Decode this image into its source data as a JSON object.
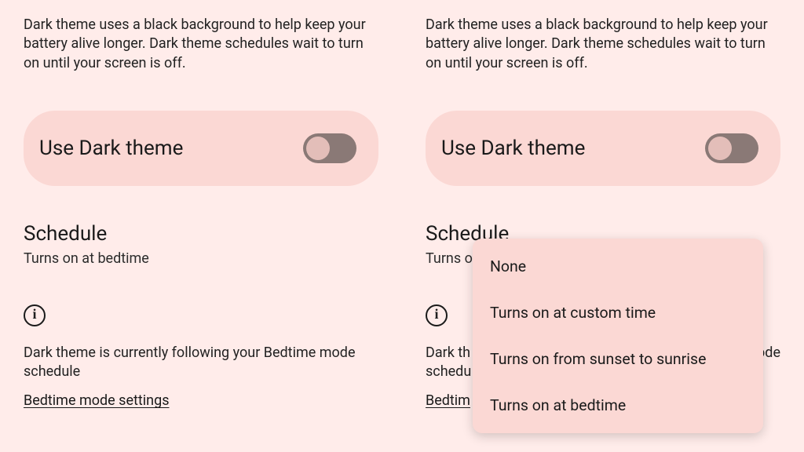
{
  "left": {
    "description": "Dark theme uses a black background to help keep your battery alive longer. Dark theme schedules wait to turn on until your screen is off.",
    "toggle_label": "Use Dark theme",
    "schedule_title": "Schedule",
    "schedule_subtitle": "Turns on at bedtime",
    "info_text": "Dark theme is currently following your Bedtime mode schedule",
    "link_label": "Bedtime mode settings"
  },
  "right": {
    "description": "Dark theme uses a black background to help keep your battery alive longer. Dark theme schedules wait to turn on until your screen is off.",
    "toggle_label": "Use Dark theme",
    "schedule_title": "Schedule",
    "schedule_subtitle_partial": "Turns o",
    "info_text_partial_start": "Dark th",
    "info_text_partial_end": "e mode",
    "info_text_partial_last": "schedu",
    "link_label_partial": "Bedtim",
    "dropdown": {
      "items": [
        "None",
        "Turns on at custom time",
        "Turns on from sunset to sunrise",
        "Turns on at bedtime"
      ]
    }
  },
  "toggle_state": {
    "left": false,
    "right": false
  },
  "colors": {
    "background": "#ffecea",
    "card": "#fbd8d4",
    "switch_track": "#8a7976",
    "switch_thumb": "#e3beb9",
    "text": "#1a1a1a"
  }
}
